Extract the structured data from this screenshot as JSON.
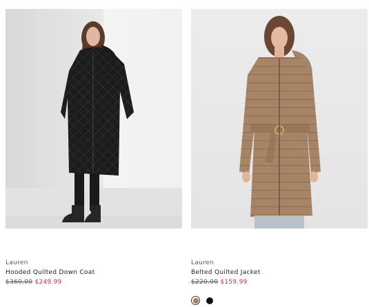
{
  "products": [
    {
      "brand": "Lauren",
      "name": "Hooded Quilted Down Coat",
      "original_price": "$360.00",
      "sale_price": "$249.99"
    },
    {
      "brand": "Lauren",
      "name": "Belted Quilted Jacket",
      "original_price": "$220.00",
      "sale_price": "$159.99",
      "swatches": [
        {
          "color": "#9d7e66",
          "selected": true
        },
        {
          "color": "#111111",
          "selected": false
        }
      ]
    }
  ],
  "colors": {
    "sale": "#c2353a",
    "coat_black": "#1b1b1d",
    "coat_tan": "#a88466"
  }
}
